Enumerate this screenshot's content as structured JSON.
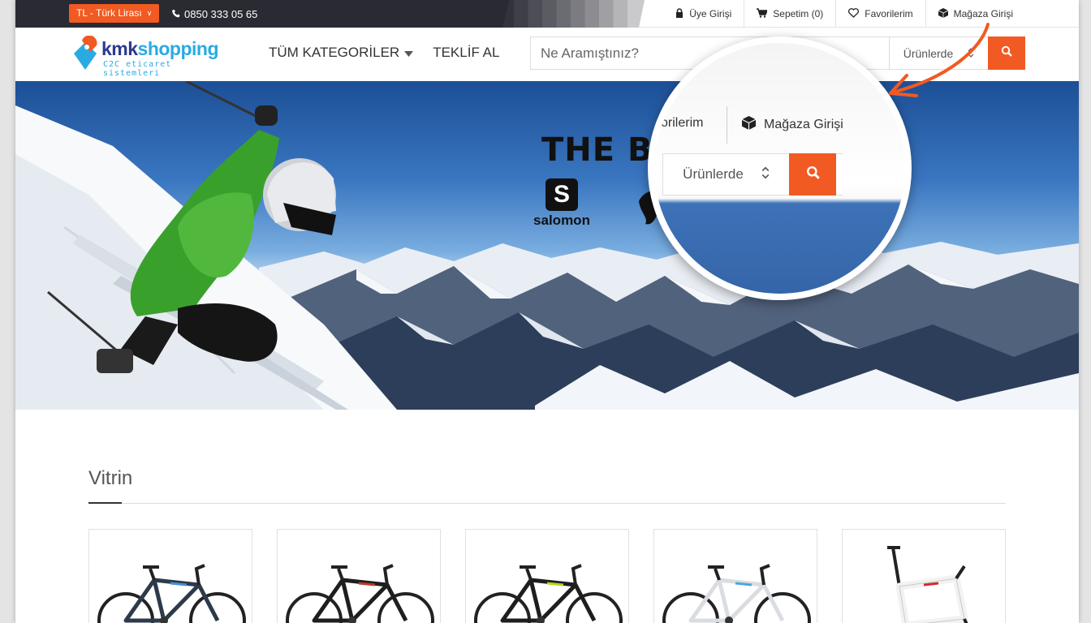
{
  "topbar": {
    "currency": "TL - Türk Lirası",
    "phone": "0850 333 05 65",
    "links": [
      {
        "label": "Üye Girişi",
        "icon": "lock-icon"
      },
      {
        "label": "Sepetim (0)",
        "icon": "cart-icon"
      },
      {
        "label": "Favorilerim",
        "icon": "heart-icon"
      },
      {
        "label": "Mağaza Girişi",
        "icon": "box-icon"
      }
    ]
  },
  "header": {
    "logo_main_1": "kmk",
    "logo_main_2": "shopping",
    "logo_sub": "C2C eticaret sistemleri",
    "nav": [
      {
        "label": "TÜM KATEGORİLER"
      },
      {
        "label": "TEKLİF AL"
      }
    ],
    "search": {
      "placeholder": "Ne Aramıştınız?",
      "scope": "Ürünlerde"
    }
  },
  "hero": {
    "title": "THE BES",
    "brand": "salomon"
  },
  "magnifier": {
    "link_partial": "vorilerim",
    "link_store": "Mağaza Girişi",
    "scope": "Ürünlerde"
  },
  "vitrin": {
    "title": "Vitrin",
    "products": [
      {
        "name": "bike-1",
        "frame_color": "#2d3a4a",
        "accent": "#4a8fd6"
      },
      {
        "name": "bike-2",
        "frame_color": "#1e1e1e",
        "accent": "#c0392b"
      },
      {
        "name": "bike-3",
        "frame_color": "#1e1e1e",
        "accent": "#b7d31c"
      },
      {
        "name": "bike-4",
        "frame_color": "#d9dde2",
        "accent": "#4aa8d8"
      },
      {
        "name": "bike-frame-5",
        "frame_color": "#f2f2f2",
        "accent": "#d12c2c"
      }
    ]
  },
  "colors": {
    "accent": "#f15a22",
    "topbar_dark": "#2a2a33",
    "logo_blue": "#29abe2",
    "logo_navy": "#2b3990"
  }
}
